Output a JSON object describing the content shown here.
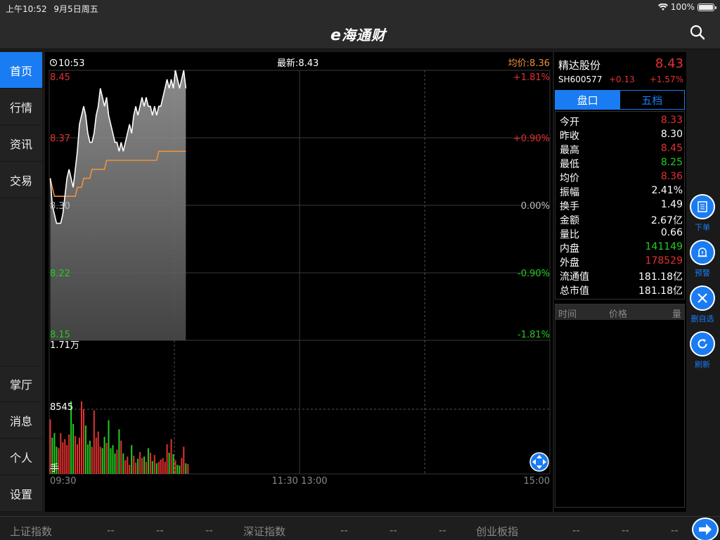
{
  "status": {
    "time": "上午10:52",
    "date": "9月5日周五",
    "battery": "100%"
  },
  "header": {
    "logo_e": "e",
    "logo_text": "海通财"
  },
  "sidebar": {
    "items": [
      {
        "label": "首页",
        "active": true
      },
      {
        "label": "行情",
        "active": false
      },
      {
        "label": "资讯",
        "active": false
      },
      {
        "label": "交易",
        "active": false
      },
      {
        "label": "掌厅",
        "active": false
      },
      {
        "label": "消息",
        "active": false
      },
      {
        "label": "个人",
        "active": false
      },
      {
        "label": "设置",
        "active": false
      }
    ]
  },
  "chart_header": {
    "time": "10:53",
    "latest": "最新:8.43",
    "avg": "均价:8.36"
  },
  "chart_data": {
    "type": "line",
    "title": "",
    "price_axis": {
      "labels": [
        "8.45",
        "8.37",
        "8.30",
        "8.22",
        "8.15"
      ],
      "ylim": [
        8.15,
        8.45
      ]
    },
    "pct_axis": {
      "labels": [
        "+1.81%",
        "+0.90%",
        "0.00%",
        "-0.90%",
        "-1.81%"
      ]
    },
    "x_ticks": [
      "09:30",
      "11:30 13:00",
      "15:00"
    ],
    "volume_axis": {
      "labels": [
        "1.71万",
        "8545",
        "手"
      ],
      "ymax": 17100
    },
    "series": [
      {
        "values": [
          8.33,
          8.3,
          8.29,
          8.28,
          8.28,
          8.28,
          8.29,
          8.31,
          8.33,
          8.34,
          8.33,
          8.32,
          8.34,
          8.36,
          8.39,
          8.4,
          8.41,
          8.4,
          8.38,
          8.37,
          8.37,
          8.38,
          8.4,
          8.41,
          8.43,
          8.42,
          8.41,
          8.42,
          8.4,
          8.39,
          8.38,
          8.37,
          8.37,
          8.36,
          8.37,
          8.36,
          8.37,
          8.38,
          8.39,
          8.38,
          8.4,
          8.41,
          8.4,
          8.41,
          8.42,
          8.41,
          8.42,
          8.41,
          8.41,
          8.4,
          8.41,
          8.4,
          8.41,
          8.41,
          8.42,
          8.43,
          8.44,
          8.43,
          8.44,
          8.43,
          8.45,
          8.44,
          8.43,
          8.44,
          8.45,
          8.43
        ]
      },
      {
        "values": [
          8.33,
          8.32,
          8.31,
          8.31,
          8.31,
          8.31,
          8.31,
          8.31,
          8.31,
          8.31,
          8.31,
          8.31,
          8.31,
          8.32,
          8.32,
          8.32,
          8.33,
          8.33,
          8.33,
          8.33,
          8.34,
          8.34,
          8.34,
          8.34,
          8.34,
          8.34,
          8.34,
          8.35,
          8.35,
          8.35,
          8.35,
          8.35,
          8.35,
          8.35,
          8.35,
          8.35,
          8.35,
          8.35,
          8.35,
          8.35,
          8.35,
          8.35,
          8.35,
          8.35,
          8.35,
          8.35,
          8.35,
          8.35,
          8.35,
          8.35,
          8.35,
          8.35,
          8.36,
          8.36,
          8.36,
          8.36,
          8.36,
          8.36,
          8.36,
          8.36,
          8.36,
          8.36,
          8.36,
          8.36,
          8.36,
          8.36
        ]
      }
    ],
    "volume": [
      7200,
      4800,
      5400,
      3600,
      3400,
      5400,
      4200,
      4600,
      3800,
      5200,
      9600,
      6600,
      5000,
      3900,
      4800,
      9600,
      8600,
      6400,
      3900,
      4400,
      3600,
      8400,
      4800,
      5600,
      3600,
      3400,
      4900,
      4100,
      7100,
      3400,
      3800,
      2700,
      3200,
      5900,
      4400,
      2700,
      1800,
      2300,
      1200,
      3800,
      2400,
      1500,
      2000,
      2900,
      2100,
      2300,
      1600,
      3400,
      2800,
      1700,
      2500,
      1400,
      1600,
      1900,
      2100,
      1600,
      3900,
      2800,
      4600,
      2600,
      1800,
      1200,
      1100,
      2100,
      3600,
      1400,
      1300
    ]
  },
  "quote": {
    "name": "精达股份",
    "price": "8.43",
    "code": "SH600577",
    "change": "+0.13",
    "change_pct": "+1.57%",
    "tabs": [
      {
        "label": "盘口",
        "active": true
      },
      {
        "label": "五档",
        "active": false
      }
    ],
    "stats": [
      {
        "label": "今开",
        "value": "8.33",
        "color": "#e53030"
      },
      {
        "label": "昨收",
        "value": "8.30",
        "color": "#ffffff"
      },
      {
        "label": "最高",
        "value": "8.45",
        "color": "#e53030"
      },
      {
        "label": "最低",
        "value": "8.25",
        "color": "#22cc22"
      },
      {
        "label": "均价",
        "value": "8.36",
        "color": "#e53030"
      },
      {
        "label": "振幅",
        "value": "2.41%",
        "color": "#ffffff"
      },
      {
        "label": "换手",
        "value": "1.49",
        "color": "#ffffff"
      },
      {
        "label": "金额",
        "value": "2.67亿",
        "color": "#ffffff"
      },
      {
        "label": "量比",
        "value": "0.66",
        "color": "#ffffff"
      },
      {
        "label": "内盘",
        "value": "141149",
        "color": "#22cc22"
      },
      {
        "label": "外盘",
        "value": "178529",
        "color": "#e53030"
      },
      {
        "label": "流通值",
        "value": "181.18亿",
        "color": "#ffffff"
      },
      {
        "label": "总市值",
        "value": "181.18亿",
        "color": "#ffffff"
      }
    ],
    "trade_headers": [
      "时间",
      "价格",
      "量"
    ]
  },
  "actions": [
    {
      "label": "下单",
      "icon": "order-icon"
    },
    {
      "label": "预警",
      "icon": "alarm-icon"
    },
    {
      "label": "删自选",
      "icon": "close-icon"
    },
    {
      "label": "刷新",
      "icon": "refresh-icon"
    }
  ],
  "bottom": {
    "indices": [
      {
        "name": "上证指数",
        "v1": "--",
        "v2": "--",
        "v3": "--"
      },
      {
        "name": "深证指数",
        "v1": "--",
        "v2": "--",
        "v3": "--"
      },
      {
        "name": "创业板指",
        "v1": "--",
        "v2": "--",
        "v3": "--"
      }
    ]
  },
  "colors": {
    "accent": "#1a7cf2",
    "up": "#e53030",
    "down": "#22cc22",
    "avg": "#f0913a"
  }
}
